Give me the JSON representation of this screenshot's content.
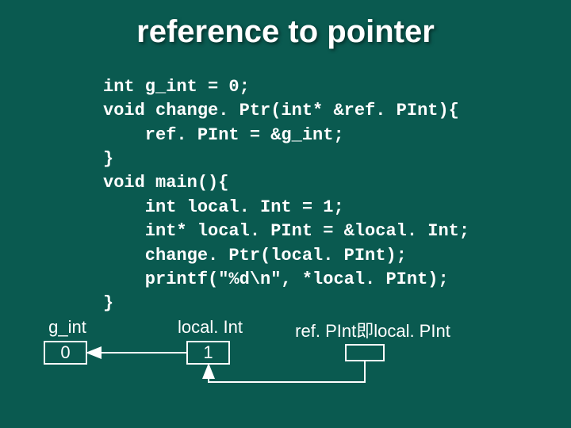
{
  "title": "reference to pointer",
  "code": "int g_int = 0;\nvoid change. Ptr(int* &ref. PInt){\n    ref. PInt = &g_int;\n}\nvoid main(){\n    int local. Int = 1;\n    int* local. PInt = &local. Int;\n    change. Ptr(local. PInt);\n    printf(\"%d\\n\", *local. PInt);\n}",
  "diagram": {
    "gint_label": "g_int",
    "gint_value": "0",
    "localint_label": "local. Int",
    "localint_value": "1",
    "refpint_label": "ref. PInt即local. PInt"
  }
}
